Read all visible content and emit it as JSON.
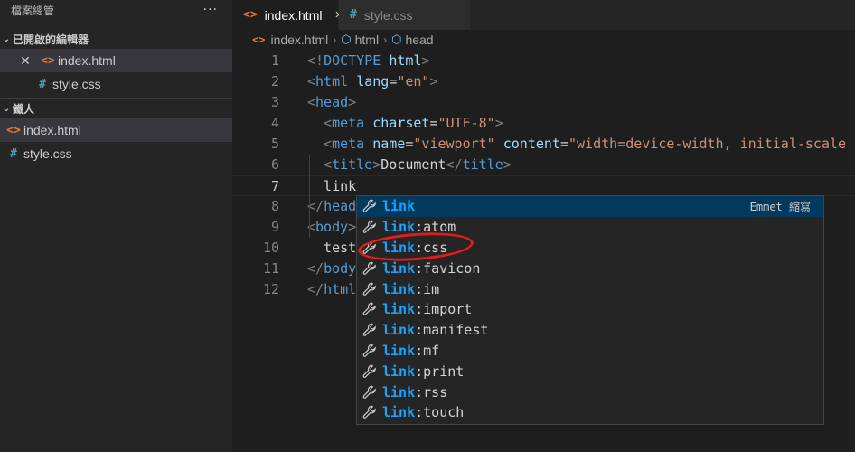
{
  "sidebar": {
    "title": "檔案總管",
    "more_icon": "ellipsis-icon",
    "open_editors": {
      "label": "已開啟的編輯器",
      "items": [
        {
          "label": "index.html",
          "icon": "html-file-icon",
          "active": true
        },
        {
          "label": "style.css",
          "icon": "css-file-icon",
          "active": false
        }
      ]
    },
    "repo": {
      "label": "鐵人",
      "items": [
        {
          "label": "index.html",
          "icon": "html-file-icon",
          "active": true
        },
        {
          "label": "style.css",
          "icon": "css-file-icon",
          "active": false
        }
      ]
    }
  },
  "tabs": [
    {
      "label": "index.html",
      "icon": "html-file-icon",
      "active": true,
      "close": "×"
    },
    {
      "label": "style.css",
      "icon": "css-file-icon",
      "active": false
    }
  ],
  "breadcrumb": [
    "index.html",
    "html",
    "head"
  ],
  "editor": {
    "current_line": 7,
    "line_numbers": [
      "1",
      "2",
      "3",
      "4",
      "5",
      "6",
      "7",
      "8",
      "9",
      "10",
      "11",
      "12"
    ]
  },
  "suggest": {
    "detail": "Emmet 縮寫",
    "items": [
      {
        "match": "link",
        "rest": ""
      },
      {
        "match": "link",
        "rest": ":atom"
      },
      {
        "match": "link",
        "rest": ":css"
      },
      {
        "match": "link",
        "rest": ":favicon"
      },
      {
        "match": "link",
        "rest": ":im"
      },
      {
        "match": "link",
        "rest": ":import"
      },
      {
        "match": "link",
        "rest": ":manifest"
      },
      {
        "match": "link",
        "rest": ":mf"
      },
      {
        "match": "link",
        "rest": ":print"
      },
      {
        "match": "link",
        "rest": ":rss"
      },
      {
        "match": "link",
        "rest": ":touch"
      }
    ]
  },
  "colors": {
    "accent": "#18a3ff",
    "selection": "#04395e",
    "annotation": "#e21b1b"
  }
}
